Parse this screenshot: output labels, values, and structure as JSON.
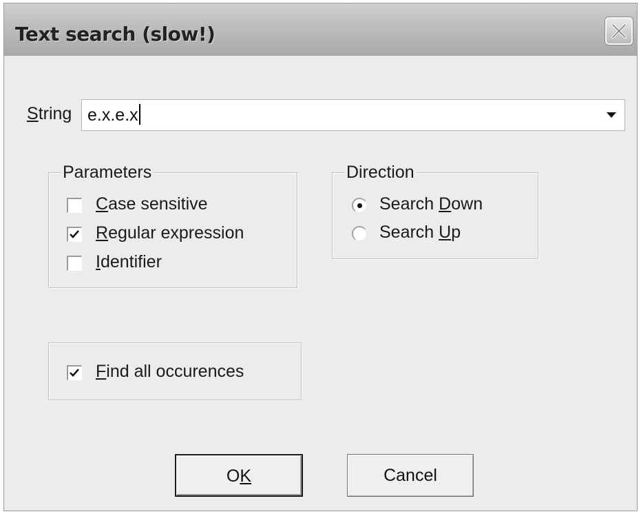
{
  "window": {
    "title": "Text search (slow!)",
    "close_icon": "close-icon"
  },
  "search": {
    "label_prefix": "",
    "label_mnemonic": "S",
    "label_rest": "tring",
    "value": "e.x.e.x",
    "dropdown_icon": "dropdown-arrow-icon"
  },
  "parameters": {
    "title": "Parameters",
    "options": [
      {
        "mnemonic": "C",
        "rest": "ase sensitive",
        "checked": false
      },
      {
        "mnemonic": "R",
        "rest": "egular expression",
        "checked": true
      },
      {
        "mnemonic": "I",
        "rest": "dentifier",
        "checked": false
      }
    ]
  },
  "direction": {
    "title": "Direction",
    "options": [
      {
        "before": "Search ",
        "mnemonic": "D",
        "rest": "own",
        "selected": true
      },
      {
        "before": "Search ",
        "mnemonic": "U",
        "rest": "p",
        "selected": false
      }
    ]
  },
  "find_all": {
    "mnemonic": "F",
    "rest": "ind all occurences",
    "checked": true
  },
  "buttons": {
    "ok_prefix": "O",
    "ok_mnemonic": "K",
    "cancel": "Cancel"
  },
  "colors": {
    "dialog_bg": "#ececec",
    "titlebar": "#bdbdbd"
  }
}
